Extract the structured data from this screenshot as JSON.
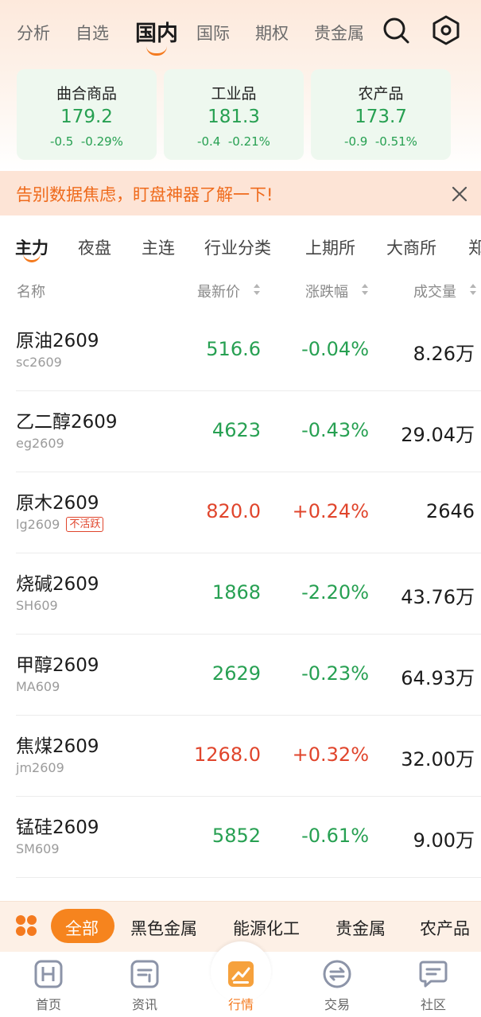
{
  "top_tabs": {
    "items": [
      "分析",
      "自选",
      "国内",
      "国际",
      "期权",
      "贵金属"
    ],
    "active": "国内"
  },
  "header_icons": [
    "search-icon",
    "settings-hexagon-icon"
  ],
  "index_cards": [
    {
      "name": "曲合商品",
      "value": "179.2",
      "change": "-0.5",
      "change_pct": "-0.29%"
    },
    {
      "name": "工业品",
      "value": "181.3",
      "change": "-0.4",
      "change_pct": "-0.21%"
    },
    {
      "name": "农产品",
      "value": "173.7",
      "change": "-0.9",
      "change_pct": "-0.51%"
    }
  ],
  "banner": {
    "text": "告别数据焦虑，盯盘神器了解一下!",
    "close_icon": "close-icon"
  },
  "sub_tabs": {
    "items": [
      "主力",
      "夜盘",
      "主连",
      "行业分类",
      "上期所",
      "大商所",
      "郑"
    ],
    "active": "主力"
  },
  "columns": {
    "name": "名称",
    "price": "最新价",
    "change": "涨跌幅",
    "volume": "成交量"
  },
  "rows": [
    {
      "name": "原油2609",
      "code": "sc2609",
      "badge": "",
      "price": "516.6",
      "change": "-0.04%",
      "volume": "8.26万",
      "trend": "down"
    },
    {
      "name": "乙二醇2609",
      "code": "eg2609",
      "badge": "",
      "price": "4623",
      "change": "-0.43%",
      "volume": "29.04万",
      "trend": "down"
    },
    {
      "name": "原木2609",
      "code": "lg2609",
      "badge": "不活跃",
      "price": "820.0",
      "change": "+0.24%",
      "volume": "2646",
      "trend": "up"
    },
    {
      "name": "烧碱2609",
      "code": "SH609",
      "badge": "",
      "price": "1868",
      "change": "-2.20%",
      "volume": "43.76万",
      "trend": "down"
    },
    {
      "name": "甲醇2609",
      "code": "MA609",
      "badge": "",
      "price": "2629",
      "change": "-0.23%",
      "volume": "64.93万",
      "trend": "down"
    },
    {
      "name": "焦煤2609",
      "code": "jm2609",
      "badge": "",
      "price": "1268.0",
      "change": "+0.32%",
      "volume": "32.00万",
      "trend": "up"
    },
    {
      "name": "锰硅2609",
      "code": "SM609",
      "badge": "",
      "price": "5852",
      "change": "-0.61%",
      "volume": "9.00万",
      "trend": "down"
    }
  ],
  "categories": {
    "items": [
      "全部",
      "黑色金属",
      "能源化工",
      "贵金属",
      "农产品"
    ],
    "active": "全部"
  },
  "bottom_nav": {
    "items": [
      {
        "label": "首页",
        "icon": "home-h-icon"
      },
      {
        "label": "资讯",
        "icon": "news-icon"
      },
      {
        "label": "行情",
        "icon": "market-chart-icon"
      },
      {
        "label": "交易",
        "icon": "trade-exchange-icon"
      },
      {
        "label": "社区",
        "icon": "community-chat-icon"
      }
    ],
    "active": "行情"
  },
  "colors": {
    "accent": "#f47a1f",
    "up": "#e0452c",
    "down": "#27a052",
    "banner_bg": "#fde4d6",
    "card_bg": "#eef8ef"
  }
}
